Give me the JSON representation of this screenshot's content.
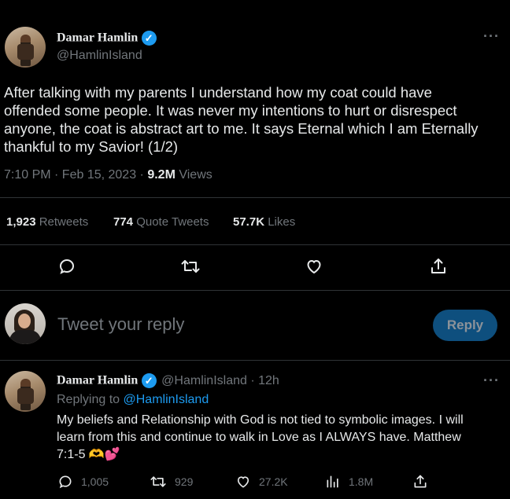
{
  "main_tweet": {
    "author_name": "Damar Hamlin",
    "verified_glyph": "✓",
    "handle": "@HamlinIsland",
    "more_glyph": "···",
    "text_lines": [
      "After talking with my parents I understand how my coat could have",
      "offended some people. It was never my intentions to hurt or disrespect",
      "anyone, the coat is abstract art to me. It says Eternal which I am Eternally",
      "thankful to my Savior! (1/2)"
    ],
    "time": "7:10 PM · Feb 15, 2023 · ",
    "views_count": "9.2M",
    "views_label": " Views",
    "retweets_count": "1,923",
    "retweets_label": " Retweets",
    "quotes_count": "774",
    "quotes_label": " Quote Tweets",
    "likes_count": "57.7K",
    "likes_label": " Likes",
    "icons": [
      "reply-icon",
      "retweet-icon",
      "like-icon",
      "share-icon"
    ]
  },
  "composer": {
    "placeholder": "Tweet your reply",
    "reply_button": "Reply"
  },
  "reply_tweet": {
    "author_name": "Damar Hamlin",
    "verified_glyph": "✓",
    "handle_time": "@HamlinIsland · 12h",
    "more_glyph": "···",
    "replying_prefix": "Replying to ",
    "replying_handle": "@HamlinIsland",
    "text_lines": [
      "My beliefs and Relationship with God is not tied to symbolic images. I will",
      "learn from this and continue to walk in Love as I ALWAYS have. Matthew",
      "7:1-5"
    ],
    "emoji": "🫶💕",
    "reply_count": "1,005",
    "retweet_count": "929",
    "like_count": "27.2K",
    "views_count": "1.8M",
    "icons": [
      "reply-icon",
      "retweet-icon",
      "like-icon",
      "views-icon",
      "share-icon"
    ]
  },
  "colors": {
    "background": "#000000",
    "text": "#e7e9ea",
    "muted": "#71767b",
    "accent": "#1d9bf0",
    "reply_button_bg": "#0e4f7e"
  }
}
